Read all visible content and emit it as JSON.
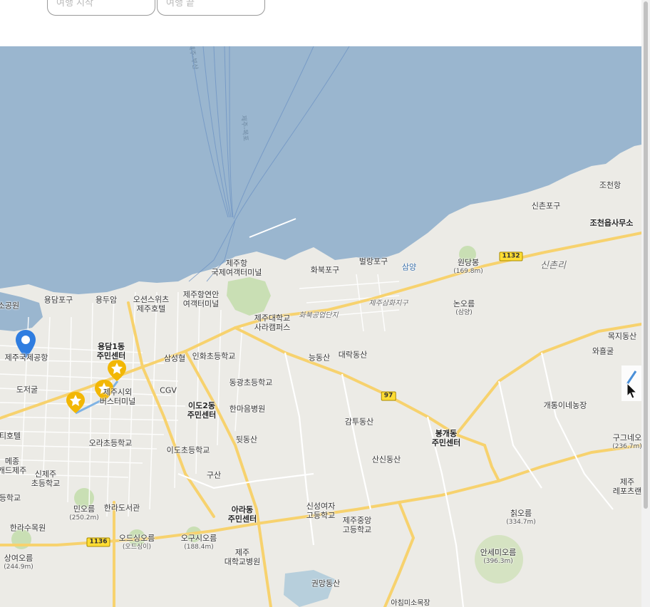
{
  "trip_form": {
    "start_placeholder": "여행 시작",
    "end_placeholder": "여행 끝"
  },
  "colors": {
    "sea": "#9ab6cf",
    "land": "#ecebe6",
    "road_major": "#f7d26e",
    "road_minor": "#ffffff",
    "park": "#c9dfb4",
    "route_line": "#7fb3e4",
    "pin_blue": "#2f7de0",
    "pin_gold": "#f2b705"
  },
  "map": {
    "route_numbers": [
      "1132",
      "97",
      "1136"
    ],
    "landmarks": {
      "jocheon_port": "조천항",
      "sinchon_port": "신촌포구",
      "jocheon_office": "조천읍사무소",
      "sinchon_ri": "신촌리",
      "wondangbong": "원당봉",
      "wondangbong_h": "(169.8m)",
      "samyang": "삼양",
      "beollang_port": "벌랑포구",
      "hwabuk_port": "화북포구",
      "jeju_port": "제주항",
      "jeju_port_terminal": "국제여객터미널",
      "coastal_terminal_1": "제주항연안",
      "coastal_terminal_2": "여객터미널",
      "oceans_suites_1": "오션스위츠",
      "oceans_suites_2": "제주호텔",
      "yongduam": "용두암",
      "yongdam_port": "용담포구",
      "park_left": "소공원",
      "airport": "제주국제공항",
      "dojeolgul": "도저굴",
      "yongdam1_1": "용담1동",
      "yongdam1_2": "주민센터",
      "samsunghyeol": "삼성혈",
      "inhwa_school": "인화초등학교",
      "cgv": "CGV",
      "bus_terminal_1": "제주시외",
      "bus_terminal_2": "버스터미널",
      "ido2_1": "이도2동",
      "ido2_2": "주민센터",
      "donggwang_school": "동광초등학교",
      "hanmaeum": "한마음병원",
      "ora_school": "오라초등학교",
      "ido_school": "이도초등학교",
      "uni_campus_1": "제주대학교",
      "uni_campus_2": "사라캠퍼스",
      "hwabuk_industrial": "화북공업단지",
      "jeju_samhwa": "제주삼화지구",
      "neungdongsan": "능동산",
      "daerakdongsan": "대락동산",
      "nonoreum": "논오름",
      "nonoreum_sub": "(삼양)",
      "mokjidongsan": "목지동산",
      "wahulgul": "와흘굴",
      "gaetongi_farm": "개통이네농장",
      "gugineo_1": "구그네오",
      "gugineo_h": "(236.7m)",
      "jeju_leports_1": "제주",
      "jeju_leports_2": "레포츠랜",
      "gamtudongsan": "감투동산",
      "bonggae_1": "봉개동",
      "bonggae_2": "주민센터",
      "sansindongsan": "산신동산",
      "dwitdongsan": "뒷동산",
      "gusan": "구산",
      "ara_1": "아라동",
      "ara_2": "주민센터",
      "sinseong_1": "신성여자",
      "sinseong_2": "고등학교",
      "jeju_central_1": "제주중앙",
      "jeju_central_2": "고등학교",
      "chwioreum": "칡오름",
      "chwioreum_h": "(334.7m)",
      "ansemi_1": "안세미오름",
      "ansemi_h": "(396.3m)",
      "minoreum": "민오름",
      "minoreum_h": "(250.2m)",
      "halla_library": "한라도서관",
      "odeungsaeoreum": "오드싱오름",
      "odeungsaeoreum_sub": "(오드싱이)",
      "ogusioreum": "오구시오름",
      "ogusioreum_h": "(188.4m)",
      "jeju_uni_hosp_1": "제주",
      "jeju_uni_hosp_2": "대학교병원",
      "hallasu": "한라수목원",
      "sangyeooreum": "상여오름",
      "sangyeooreum_h": "(244.9m)",
      "sinjeju_school_1": "신제주",
      "sinjeju_school_2": "초등학교",
      "hotel_left": "티호텔",
      "maison_1": "메종",
      "maison_2": "캐드제주",
      "school_left": "등학교",
      "gwonmangdongsan": "권망동산",
      "achimmisu": "아침미소목장",
      "ferry_route_1": "제주-부산",
      "ferry_route_2": "제주-목포"
    }
  }
}
